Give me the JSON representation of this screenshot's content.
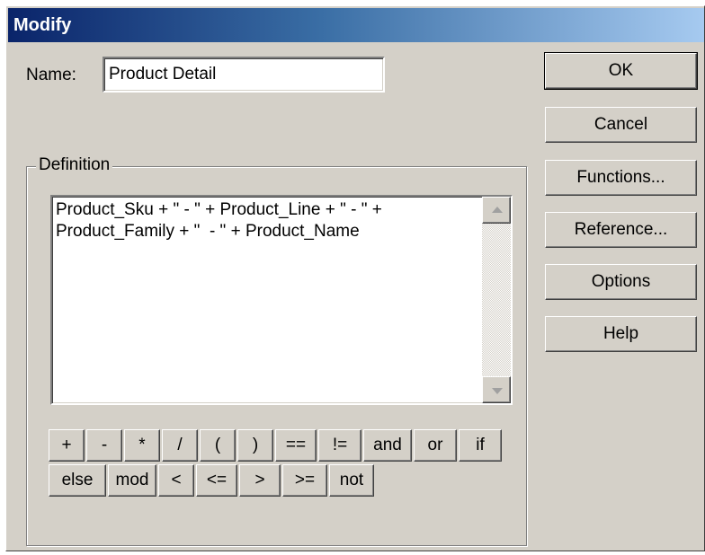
{
  "window": {
    "title": "Modify"
  },
  "name_field": {
    "label": "Name:",
    "value": "Product Detail"
  },
  "definition": {
    "group_label": "Definition",
    "text": "Product_Sku + \" - \" + Product_Line + \" - \" +\nProduct_Family + \"  - \" + Product_Name"
  },
  "side_buttons": {
    "ok": "OK",
    "cancel": "Cancel",
    "functions": "Functions...",
    "reference": "Reference...",
    "options": "Options",
    "help": "Help"
  },
  "operators": {
    "row1": [
      "+",
      "-",
      "*",
      "/",
      "(",
      ")",
      "==",
      "!=",
      "and",
      "or",
      "if"
    ],
    "row2": [
      "else",
      "mod",
      "<",
      "<=",
      ">",
      ">=",
      "not"
    ]
  },
  "colors": {
    "dialog_face": "#d4d0c8",
    "titlebar_start": "#0a246a",
    "titlebar_end": "#a6caf0"
  },
  "icons": {
    "scroll_up": "arrow-up-icon",
    "scroll_down": "arrow-down-icon"
  }
}
